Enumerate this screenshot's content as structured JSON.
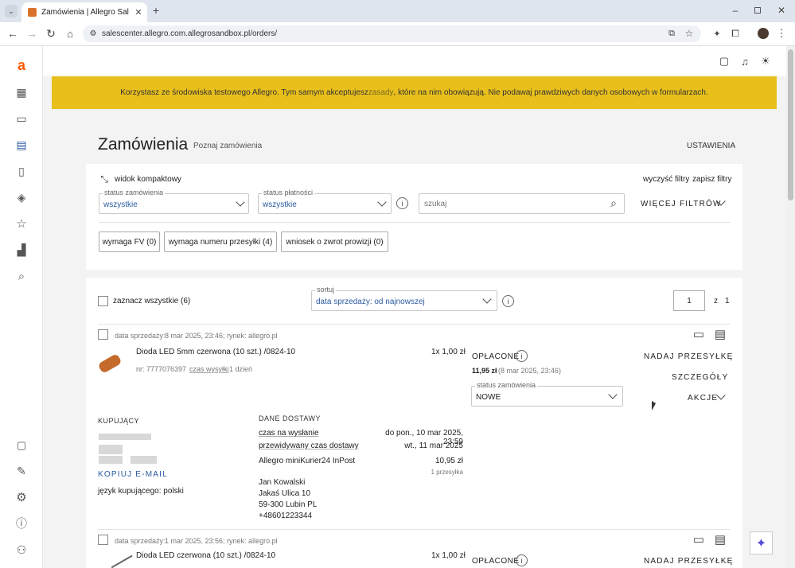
{
  "browser": {
    "tab_title": "Zamówienia | Allegro Sales Cen",
    "url": "salescenter.allegro.com.allegrosandbox.pl/orders/"
  },
  "banner": {
    "text_before": "Korzystasz ze środowiska testowego Allegro. Tym samym akceptujesz ",
    "link": "zasady",
    "text_after": ", które na nim obowiązują. Nie podawaj prawdziwych danych osobowych w formularzach."
  },
  "header": {
    "title": "Zamówienia",
    "learn_link": "Poznaj zamówienia",
    "settings": "USTAWIENIA"
  },
  "filters": {
    "compact_view": "widok kompaktowy",
    "clear": "wyczyść filtry",
    "save": "zapisz filtry",
    "order_status_label": "status zamówienia",
    "order_status_value": "wszystkie",
    "payment_status_label": "status płatności",
    "payment_status_value": "wszystkie",
    "search_placeholder": "szukaj",
    "more_filters": "WIĘCEJ FILTRÓW",
    "chips": [
      "wymaga FV (0)",
      "wymaga numeru przesyłki (4)",
      "wniosek o zwrot prowizji (0)"
    ]
  },
  "list": {
    "select_all": "zaznacz wszystkie (6)",
    "sort_label": "sortuj",
    "sort_value": "data sprzedaży: od najnowszej",
    "page": "1",
    "page_of": "z",
    "page_total": "1"
  },
  "order1": {
    "date_label": "data sprzedaży:",
    "date_value": "8 mar 2025, 23:46; rynek: allegro.pl",
    "product": "Dioda LED 5mm czerwona (10 szt.) /0824-10",
    "qty_price": "1x 1,00 zł",
    "nr_label": "nr: 7777076397",
    "ship_time_label": "czas wysyłki",
    "ship_time_value": ": 1 dzień",
    "paid": "OPŁACONE",
    "amount": "11,95 zł",
    "amount_date": "(8 mar 2025, 23:46)",
    "status_label": "status zamówienia",
    "status_value": "NOWE",
    "send_package": "NADAJ PRZESYŁKĘ",
    "details": "SZCZEGÓŁY",
    "actions": "AKCJE",
    "buyer_label": "KUPUJĄCY",
    "copy_email": "KOPIUJ E-MAIL",
    "buyer_lang": "język kupującego: polski",
    "delivery_label": "DANE DOSTAWY",
    "ship_by_label": "czas na wysłanie",
    "ship_by_value": "do pon., 10 mar 2025, 23:59",
    "eta_label": "przewidywany czas dostawy",
    "eta_value": "wt., 11 mar 2025",
    "carrier": "Allegro miniKurier24 InPost",
    "carrier_price": "10,95 zł",
    "parcels": "1 przesyłka",
    "addr_name": "Jan Kowalski",
    "addr_street": "Jakaś Ulica 10",
    "addr_city": "59-300 Lubin PL",
    "addr_phone": "+48601223344"
  },
  "order2": {
    "date_label": "data sprzedaży:",
    "date_value": "1 mar 2025, 23:56; rynek: allegro.pl",
    "product": "Dioda LED czerwona (10 szt.) /0824-10",
    "qty_price": "1x 1,00 zł",
    "paid": "OPŁACONE",
    "send_package": "NADAJ PRZESYŁKĘ"
  },
  "colors": {
    "banner": "#e8bf1b",
    "link": "#2a5aa0",
    "brand": "#ff5a00"
  }
}
